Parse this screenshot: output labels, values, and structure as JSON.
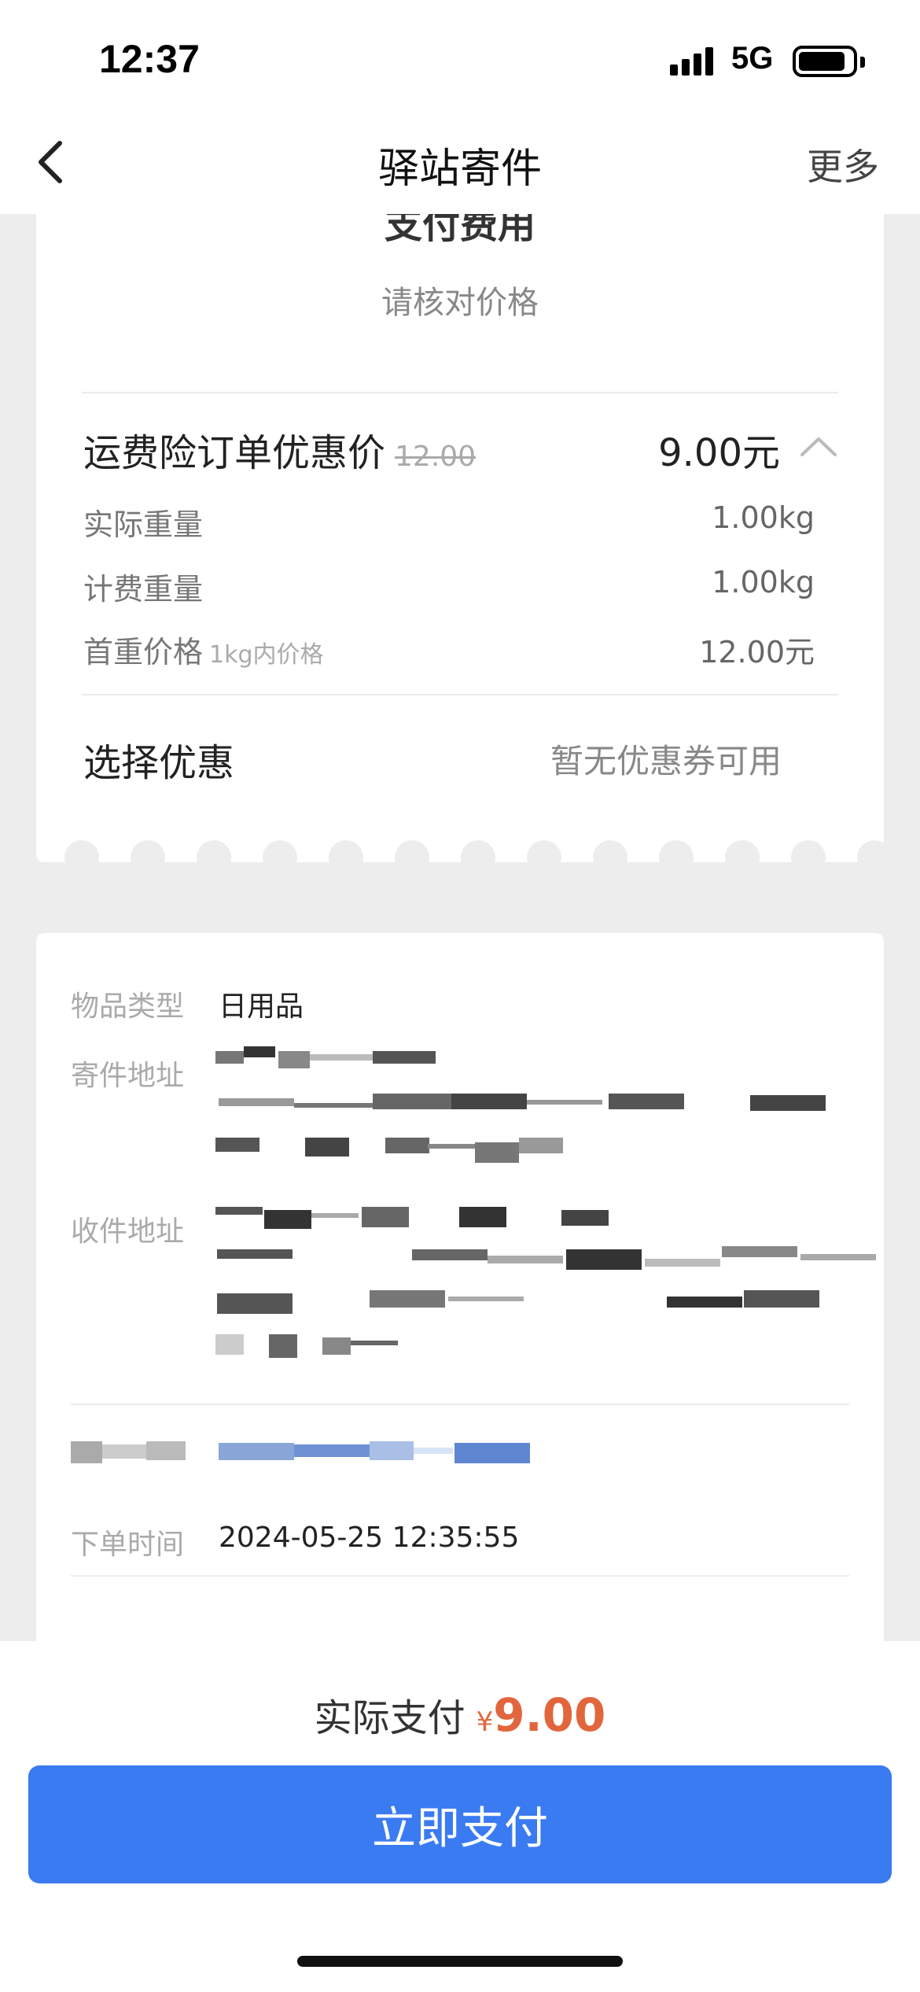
{
  "status": {
    "time": "12:37",
    "network": "5G"
  },
  "nav": {
    "title": "驿站寄件",
    "more": "更多"
  },
  "fee": {
    "heading": "支付费用",
    "subtitle": "请核对价格",
    "main_label": "运费险订单优惠价",
    "original_price": "12.00",
    "main_value": "9.00元",
    "rows": [
      {
        "label": "实际重量",
        "hint": "",
        "value": "1.00kg"
      },
      {
        "label": "计费重量",
        "hint": "",
        "value": "1.00kg"
      },
      {
        "label": "首重价格",
        "hint": "1kg内价格",
        "value": "12.00元"
      }
    ],
    "discount_label": "选择优惠",
    "discount_value": "暂无优惠券可用"
  },
  "order": {
    "item_type_label": "物品类型",
    "item_type_value": "日用品",
    "sender_label": "寄件地址",
    "receiver_label": "收件地址",
    "order_time_label": "下单时间",
    "order_time_value": "2024-05-25 12:35:55"
  },
  "payment": {
    "label": "实际支付",
    "currency": "¥",
    "amount": "9.00",
    "button": "立即支付"
  },
  "colors": {
    "accent": "#3b7bf2",
    "price": "#e2663d"
  }
}
